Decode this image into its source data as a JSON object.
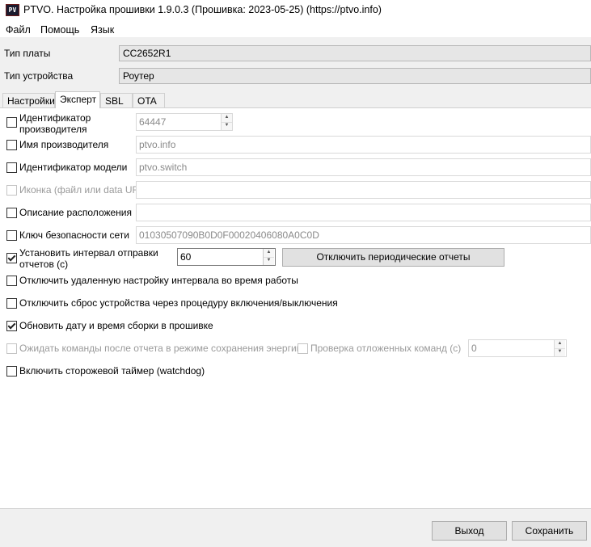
{
  "window": {
    "icon_text": "PV",
    "title": "PTVO. Настройка прошивки 1.9.0.3 (Прошивка: 2023-05-25) (https://ptvo.info)"
  },
  "menu": {
    "items": [
      {
        "label": "Файл"
      },
      {
        "label": "Помощь"
      },
      {
        "label": "Язык"
      }
    ]
  },
  "board": {
    "label": "Тип платы",
    "value": "CC2652R1"
  },
  "device": {
    "label": "Тип устройства",
    "value": "Роутер"
  },
  "tabs": [
    {
      "label": "Настройки",
      "active": false
    },
    {
      "label": "Эксперт",
      "active": true
    },
    {
      "label": "SBL",
      "active": false
    },
    {
      "label": "OTA",
      "active": false
    }
  ],
  "expert": {
    "manufacturer_id": {
      "label_line1": "Идентификатор",
      "label_line2": "производителя",
      "value": "64447",
      "checked": false
    },
    "manufacturer_name": {
      "label": "Имя производителя",
      "value": "ptvo.info",
      "checked": false
    },
    "model_id": {
      "label": "Идентификатор модели",
      "value": "ptvo.switch",
      "checked": false
    },
    "icon": {
      "label": "Иконка (файл или data URI)",
      "value": "",
      "checked": false,
      "disabled": true
    },
    "location": {
      "label": "Описание расположения",
      "value": "",
      "checked": false
    },
    "network_key": {
      "label": "Ключ безопасности сети",
      "value": "01030507090B0D0F00020406080A0C0D",
      "checked": false
    },
    "report_interval": {
      "label_line1": "Установить интервал отправки",
      "label_line2": "отчетов (с)",
      "value": "60",
      "checked": true
    },
    "disable_reports_button": "Отключить периодические отчеты",
    "disable_remote_interval": {
      "label": "Отключить удаленную настройку интервала во время работы",
      "checked": false
    },
    "disable_power_reset": {
      "label": "Отключить сброс устройства через процедуру включения/выключения",
      "checked": false
    },
    "update_build_date": {
      "label": "Обновить дату и время сборки в прошивке",
      "checked": true
    },
    "wait_commands": {
      "label": "Ожидать команды после отчета в режиме сохранения энергии",
      "checked": false,
      "disabled": true
    },
    "check_pending": {
      "label": "Проверка отложенных команд (с)",
      "value": "0",
      "checked": false,
      "disabled": true
    },
    "watchdog": {
      "label": "Включить сторожевой таймер (watchdog)",
      "checked": false
    }
  },
  "footer": {
    "exit_label": "Выход",
    "save_label": "Сохранить"
  }
}
